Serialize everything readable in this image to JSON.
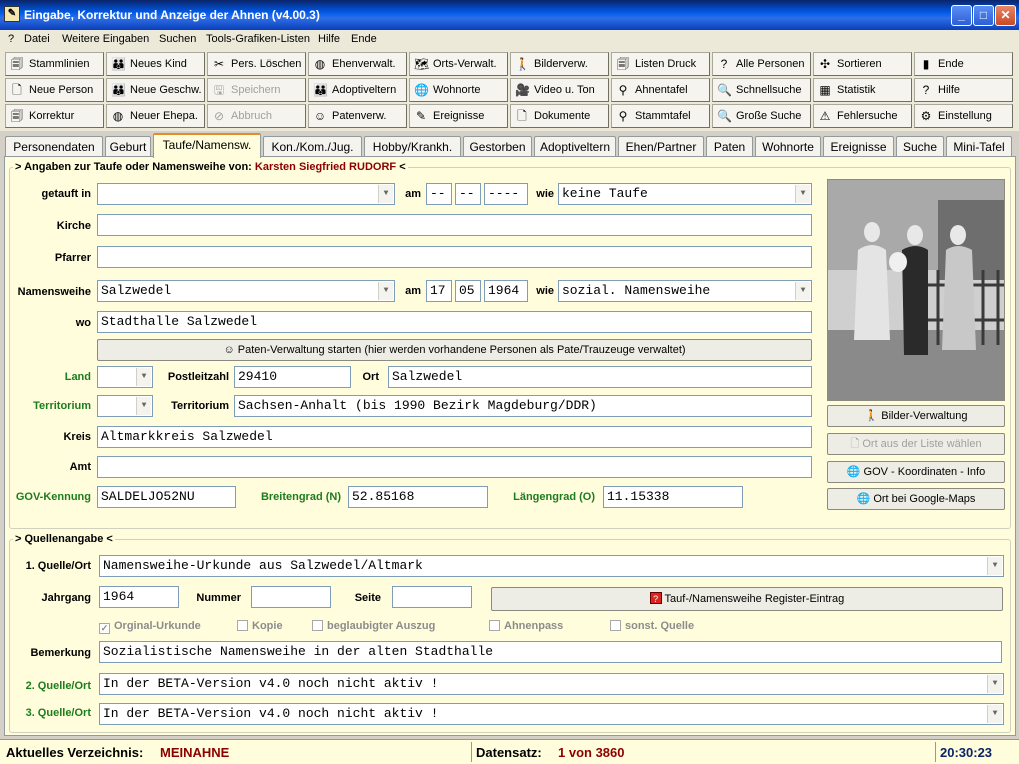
{
  "window": {
    "title": "Eingabe, Korrektur und Anzeige der Ahnen (v4.00.3)",
    "btn_min": "_",
    "btn_max": "□",
    "btn_close": "✕"
  },
  "menu": [
    "?",
    "Datei",
    "Weitere Eingaben",
    "Suchen",
    "Tools-Grafiken-Listen",
    "Hilfe",
    "Ende"
  ],
  "toolbar": [
    [
      {
        "label": "Stammlinien",
        "icon": "🗐",
        "icon_name": "tree-lines-icon"
      },
      {
        "label": "Neues Kind",
        "icon": "👪",
        "icon_name": "family-icon"
      },
      {
        "label": "Pers. Löschen",
        "icon": "✂",
        "icon_name": "delete-icon"
      },
      {
        "label": "Ehenverwalt.",
        "icon": "◍",
        "icon_name": "rings-icon"
      },
      {
        "label": "Orts-Verwalt.",
        "icon": "🗺",
        "icon_name": "map-icon"
      },
      {
        "label": "Bilderverw.",
        "icon": "🚶",
        "icon_name": "walker-icon"
      },
      {
        "label": "Listen Druck",
        "icon": "🗐",
        "icon_name": "list-icon"
      },
      {
        "label": "Alle Personen",
        "icon": "?",
        "icon_name": "question-icon"
      },
      {
        "label": "Sortieren",
        "icon": "✣",
        "icon_name": "sort-icon"
      },
      {
        "label": "Ende",
        "icon": "▮",
        "icon_name": "exit-icon"
      }
    ],
    [
      {
        "label": "Neue Person",
        "icon": "🗋",
        "icon_name": "page-icon"
      },
      {
        "label": "Neue Geschw.",
        "icon": "👪",
        "icon_name": "siblings-icon"
      },
      {
        "label": "Speichern",
        "icon": "🖫",
        "icon_name": "save-icon",
        "disabled": true
      },
      {
        "label": "Adoptiveltern",
        "icon": "👪",
        "icon_name": "adoptive-icon"
      },
      {
        "label": "Wohnorte",
        "icon": "🌐",
        "icon_name": "globe-icon"
      },
      {
        "label": "Video u. Ton",
        "icon": "🎥",
        "icon_name": "video-icon"
      },
      {
        "label": "Ahnentafel",
        "icon": "⚲",
        "icon_name": "ancestor-table-icon"
      },
      {
        "label": "Schnellsuche",
        "icon": "🔍",
        "icon_name": "quick-search-icon"
      },
      {
        "label": "Statistik",
        "icon": "▦",
        "icon_name": "statistics-icon"
      },
      {
        "label": "Hilfe",
        "icon": "?",
        "icon_name": "help-icon"
      }
    ],
    [
      {
        "label": "Korrektur",
        "icon": "🗐",
        "icon_name": "edit-icon"
      },
      {
        "label": "Neuer Ehepa.",
        "icon": "◍",
        "icon_name": "couple-icon"
      },
      {
        "label": "Abbruch",
        "icon": "⊘",
        "icon_name": "abort-icon",
        "disabled": true
      },
      {
        "label": "Patenverw.",
        "icon": "☺",
        "icon_name": "godparent-icon"
      },
      {
        "label": "Ereignisse",
        "icon": "✎",
        "icon_name": "events-icon"
      },
      {
        "label": "Dokumente",
        "icon": "🗋",
        "icon_name": "documents-icon"
      },
      {
        "label": "Stammtafel",
        "icon": "⚲",
        "icon_name": "pedigree-icon"
      },
      {
        "label": "Große Suche",
        "icon": "🔍",
        "icon_name": "big-search-icon"
      },
      {
        "label": "Fehlersuche",
        "icon": "⚠",
        "icon_name": "error-search-icon"
      },
      {
        "label": "Einstellung",
        "icon": "⚙",
        "icon_name": "settings-icon"
      }
    ]
  ],
  "tabs": [
    "Personendaten",
    "Geburt",
    "Taufe/Namensw.",
    "Kon./Kom./Jug.",
    "Hobby/Krankh.",
    "Gestorben",
    "Adoptiveltern",
    "Ehen/Partner",
    "Paten",
    "Wohnorte",
    "Ereignisse",
    "Suche",
    "Mini-Tafel"
  ],
  "taufe": {
    "legend_prefix": "> Angaben zur Taufe oder Namensweihe von:",
    "person": "Karsten Siegfried RUDORF",
    "legend_suffix": "<",
    "getauft_label": "getauft in",
    "getauft_value": "",
    "am_label": "am",
    "taufe_day": "--",
    "taufe_month": "--",
    "taufe_year": "----",
    "wie_label": "wie",
    "taufe_wie": "keine Taufe",
    "kirche_label": "Kirche",
    "kirche_value": "",
    "pfarrer_label": "Pfarrer",
    "pfarrer_value": "",
    "namensweihe_label": "Namensweihe",
    "namensweihe_value": "Salzwedel",
    "nw_day": "17",
    "nw_month": "05",
    "nw_year": "1964",
    "nw_wie": "sozial. Namensweihe",
    "wo_label": "wo",
    "wo_value": "Stadthalle Salzwedel",
    "paten_button": "Paten-Verwaltung starten (hier werden vorhandene Personen als Pate/Trauzeuge verwaltet)",
    "land_label": "Land",
    "land_value": "",
    "plz_label": "Postleitzahl",
    "plz_value": "29410",
    "ort_label": "Ort",
    "ort_value": "Salzwedel",
    "territorium_label_green": "Territorium",
    "territorium_code": "",
    "territorium_label": "Territorium",
    "territorium_value": "Sachsen-Anhalt (bis 1990 Bezirk Magdeburg/DDR)",
    "kreis_label": "Kreis",
    "kreis_value": "Altmarkkreis Salzwedel",
    "amt_label": "Amt",
    "amt_value": "",
    "gov_label": "GOV-Kennung",
    "gov_value": "SALDELJO52NU",
    "breite_label": "Breitengrad (N)",
    "breite_value": "52.85168",
    "laenge_label": "Längengrad (O)",
    "laenge_value": "11.15338"
  },
  "side_buttons": {
    "bilder": "Bilder-Verwaltung",
    "ort_liste": "Ort aus der Liste wählen",
    "gov_info": "GOV - Koordinaten - Info",
    "google_maps": "Ort bei Google-Maps"
  },
  "quellen": {
    "legend": "> Quellenangabe <",
    "q1_label": "1. Quelle/Ort",
    "q1_value": "Namensweihe-Urkunde aus Salzwedel/Altmark",
    "jahrgang_label": "Jahrgang",
    "jahrgang_value": "1964",
    "nummer_label": "Nummer",
    "nummer_value": "",
    "seite_label": "Seite",
    "seite_value": "",
    "register_button": "Tauf-/Namensweihe Register-Eintrag",
    "checks": [
      {
        "label": "Orginal-Urkunde",
        "checked": true
      },
      {
        "label": "Kopie",
        "checked": false
      },
      {
        "label": "beglaubigter Auszug",
        "checked": false
      },
      {
        "label": "Ahnenpass",
        "checked": false
      },
      {
        "label": "sonst. Quelle",
        "checked": false
      }
    ],
    "bemerkung_label": "Bemerkung",
    "bemerkung_value": "Sozialistische Namensweihe in der alten Stadthalle",
    "q2_label": "2. Quelle/Ort",
    "q2_value": "In der BETA-Version v4.0 noch nicht aktiv !",
    "q3_label": "3. Quelle/Ort",
    "q3_value": "In der BETA-Version v4.0 noch nicht aktiv !"
  },
  "status": {
    "verz_label": "Aktuelles Verzeichnis:",
    "verz_value": "MEINAHNE",
    "datensatz_label": "Datensatz:",
    "datensatz_value": "1 von 3860",
    "time": "20:30:23"
  },
  "colors": {
    "accent_red": "#8b0000",
    "label_green": "#1d7c1d",
    "panel_bg": "#fffddc"
  }
}
